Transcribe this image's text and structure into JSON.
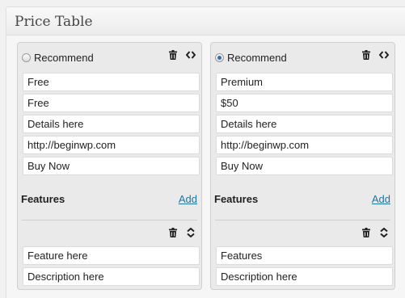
{
  "panel": {
    "title": "Price Table"
  },
  "cards": [
    {
      "recommend_label": "Recommend",
      "recommend_checked": false,
      "fields": [
        "Free",
        "Free",
        "Details here",
        "http://beginwp.com",
        "Buy Now"
      ],
      "features_label": "Features",
      "add_label": "Add",
      "feature": {
        "title": "Feature here",
        "description": "Description here"
      }
    },
    {
      "recommend_label": "Recommend",
      "recommend_checked": true,
      "fields": [
        "Premium",
        "$50",
        "Details here",
        "http://beginwp.com",
        "Buy Now"
      ],
      "features_label": "Features",
      "add_label": "Add",
      "feature": {
        "title": "Features",
        "description": "Description here"
      }
    }
  ],
  "icons": {
    "delete": "trash-icon",
    "drag": "code-arrows-icon",
    "sort": "sort-arrows-icon"
  },
  "colors": {
    "link": "#21759b",
    "radio_selected": "#2a6fb5"
  }
}
